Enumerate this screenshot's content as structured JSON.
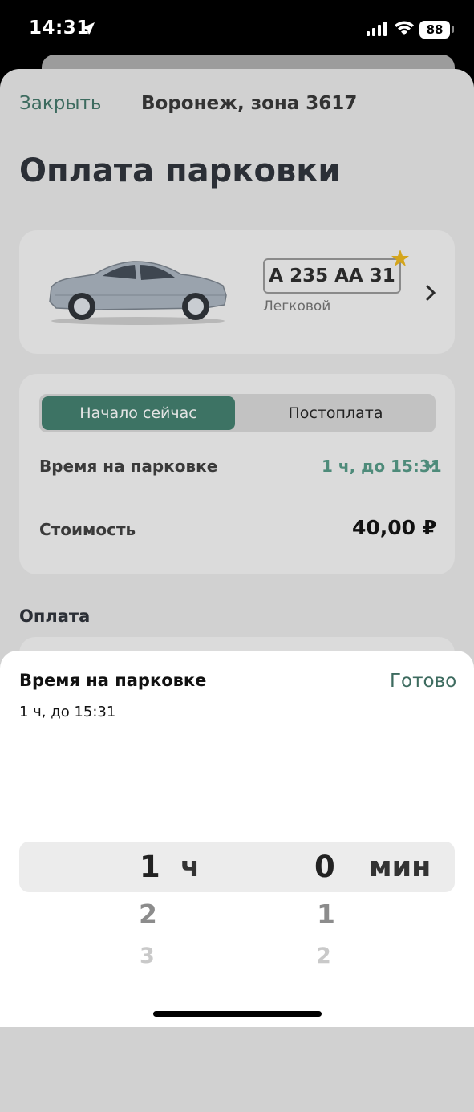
{
  "status_bar": {
    "time": "14:31",
    "battery": "88"
  },
  "header": {
    "close_label": "Закрыть",
    "zone": "Воронеж, зона 3617"
  },
  "page_title": "Оплата парковки",
  "vehicle": {
    "plate": "А 235 АА 31",
    "type": "Легковой"
  },
  "segment": {
    "options": [
      "Начало сейчас",
      "Постоплата"
    ],
    "selected": 0
  },
  "parking": {
    "time_label": "Время на парковке",
    "time_value": "1 ч, до 15:31",
    "cost_label": "Стоимость",
    "cost_value": "40,00 ₽"
  },
  "payment_section": "Оплата",
  "bottom_sheet": {
    "title": "Время на парковке",
    "done_label": "Готово",
    "summary": "1 ч, до 15:31"
  },
  "picker": {
    "hours": {
      "selected": "1",
      "unit": "ч",
      "next": [
        "2",
        "3"
      ]
    },
    "minutes": {
      "selected": "0",
      "unit": "мин",
      "next": [
        "1",
        "2"
      ]
    }
  },
  "colors": {
    "accent": "#4e8b7a",
    "segment_active": "#3d7364",
    "star": "#d4a51c"
  }
}
